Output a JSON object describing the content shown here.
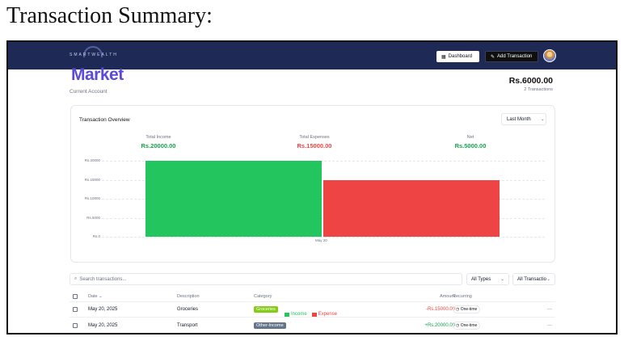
{
  "caption": "Transaction Summary:",
  "nav": {
    "logo_text": "SMARTWEALTH",
    "dashboard_label": "Dashboard",
    "add_transaction_label": "Add Transaction"
  },
  "account": {
    "title": "Market",
    "subtitle": "Current Account",
    "balance": "Rs.6000.00",
    "count": "2 Transactions"
  },
  "overview": {
    "title": "Transaction Overview",
    "range": "Last Month",
    "stats": {
      "income_label": "Total Income",
      "income_value": "Rs.20000.00",
      "expense_label": "Total Expenses",
      "expense_value": "Rs.15000.00",
      "net_label": "Net",
      "net_value": "Rs.5000.00"
    }
  },
  "chart_data": {
    "type": "bar",
    "categories": [
      "May 20"
    ],
    "series": [
      {
        "name": "Income",
        "values": [
          20000
        ],
        "color": "#22c55e"
      },
      {
        "name": "Expense",
        "values": [
          15000
        ],
        "color": "#ef4444"
      }
    ],
    "ylim": [
      0,
      20000
    ],
    "yticks": [
      "Rs.0",
      "Rs.5000",
      "Rs.10000",
      "Rs.15000",
      "Rs.20000"
    ],
    "grid": true,
    "legend_position": "bottom"
  },
  "filters": {
    "search_placeholder": "Search transactions...",
    "type_value": "All Types",
    "txn_value": "All Transactio"
  },
  "table": {
    "headers": {
      "date": "Date",
      "description": "Description",
      "category": "Category",
      "amount": "Amount",
      "recurring": "Recurring"
    },
    "rows": [
      {
        "date": "May 20, 2025",
        "description": "Groceries",
        "category": "Groceries",
        "category_color": "#84cc16",
        "amount": "-Rs.15000.00",
        "amount_color": "#ef4444",
        "recurring": "One-time"
      },
      {
        "date": "May 20, 2025",
        "description": "Transport",
        "category": "Other-Income",
        "category_color": "#64748b",
        "amount": "+Rs.20000.00",
        "amount_color": "#16a34a",
        "recurring": "One-time"
      }
    ]
  }
}
